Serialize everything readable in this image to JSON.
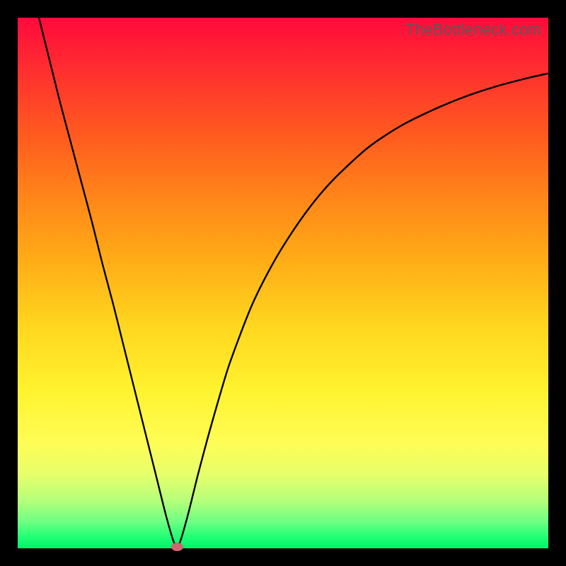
{
  "watermark": "TheBottleneck.com",
  "chart_data": {
    "type": "line",
    "title": "",
    "xlabel": "",
    "ylabel": "",
    "xlim": [
      0,
      100
    ],
    "ylim": [
      0,
      100
    ],
    "x": [
      4,
      6,
      8,
      10,
      12,
      14,
      16,
      18,
      20,
      22,
      24,
      26,
      28,
      29.5,
      30.5,
      32,
      34,
      36,
      38,
      40,
      44,
      48,
      52,
      56,
      60,
      66,
      72,
      78,
      84,
      90,
      96,
      100
    ],
    "values": [
      100,
      92,
      84,
      76.5,
      69,
      61.5,
      53.5,
      46,
      38,
      30,
      22,
      14,
      6,
      1,
      1,
      6,
      14,
      21.5,
      28.5,
      35,
      45.5,
      53.5,
      60,
      65.5,
      70,
      75.5,
      79.5,
      82.5,
      85,
      87,
      88.6,
      89.5
    ],
    "minimum_marker": {
      "x": 30,
      "y": 0
    },
    "grid": false
  },
  "colors": {
    "curve": "#000000",
    "marker": "#cc6670",
    "frame": "#000000"
  }
}
